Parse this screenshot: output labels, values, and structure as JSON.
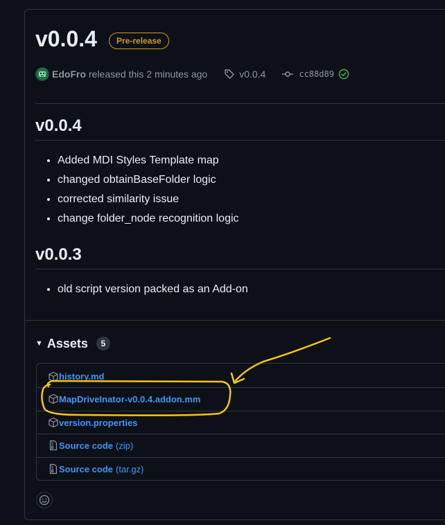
{
  "release": {
    "title": "v0.0.4",
    "badge": "Pre-release",
    "author": "EdoFro",
    "released_text": "released this 2 minutes ago",
    "tag": "v0.0.4",
    "commit": "cc88d89"
  },
  "notes": [
    {
      "heading": "v0.0.4",
      "items": [
        "Added MDI Styles Template map",
        "changed obtainBaseFolder logic",
        "corrected similarity issue",
        "change folder_node recognition logic"
      ]
    },
    {
      "heading": "v0.0.3",
      "items": [
        "old script version packed as an Add-on"
      ]
    }
  ],
  "assets": {
    "title": "Assets",
    "count": "5",
    "items": [
      {
        "name": "history.md",
        "suffix": "",
        "icon": "package-icon"
      },
      {
        "name": "MapDriveInator-v0.0.4.addon.mm",
        "suffix": "",
        "icon": "package-icon"
      },
      {
        "name": "version.properties",
        "suffix": "",
        "icon": "package-icon"
      },
      {
        "name": "Source code",
        "suffix": "(zip)",
        "icon": "file-zip-icon"
      },
      {
        "name": "Source code",
        "suffix": "(tar.gz)",
        "icon": "file-zip-icon"
      }
    ]
  },
  "colors": {
    "background": "#0d1117",
    "border": "#30363d",
    "link": "#4493f8",
    "prerelease": "#d29922",
    "verified": "#3fb950",
    "annotation": "#f5c518"
  }
}
